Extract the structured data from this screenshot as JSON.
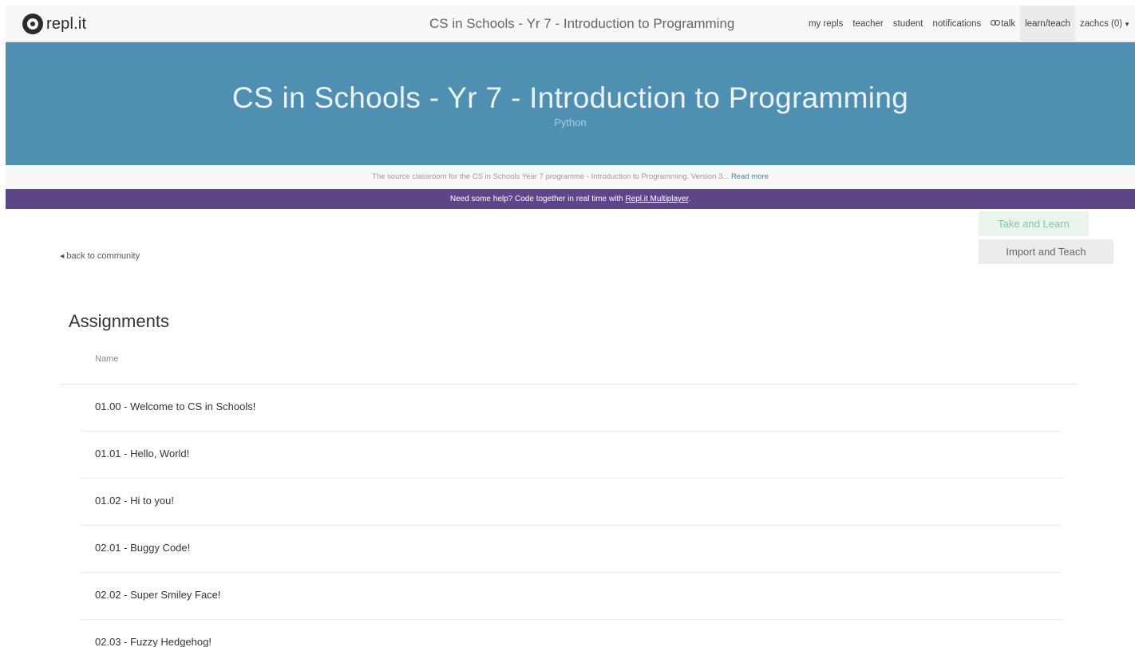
{
  "nav": {
    "logo_text": "repl.it",
    "title": "CS in Schools - Yr 7 - Introduction to Programming",
    "links": [
      {
        "label": "my repls"
      },
      {
        "label": "teacher"
      },
      {
        "label": "student"
      },
      {
        "label": "notifications"
      },
      {
        "label": "talk"
      },
      {
        "label": "learn/teach"
      },
      {
        "label": "zachcs (0)"
      }
    ]
  },
  "hero": {
    "title": "CS in Schools - Yr 7 - Introduction to Programming",
    "language": "Python"
  },
  "description": {
    "text": "The source classroom for the CS in Schools Year 7 programme - Introduction to Programming. Version 3...",
    "read_more": "Read more"
  },
  "help_banner": {
    "text": "Need some help? Code together in real time with",
    "link": "Repl.it Multiplayer",
    "suffix": "."
  },
  "actions": {
    "take_learn": "Take and Learn",
    "import_teach": "Import and Teach"
  },
  "back_link": "back to community",
  "assignments": {
    "title": "Assignments",
    "column_name": "Name",
    "rows": [
      {
        "name": "01.00 - Welcome to CS in Schools!"
      },
      {
        "name": "01.01 - Hello, World!"
      },
      {
        "name": "01.02 - Hi to you!"
      },
      {
        "name": "02.01 - Buggy Code!"
      },
      {
        "name": "02.02 - Super Smiley Face!"
      },
      {
        "name": "02.03 - Fuzzy Hedgehog!"
      }
    ]
  },
  "colors": {
    "hero_bg": "#4f8fb2",
    "help_bg": "#5c4589",
    "take_bg": "#e9f5ec",
    "link": "#3a7ec2"
  }
}
